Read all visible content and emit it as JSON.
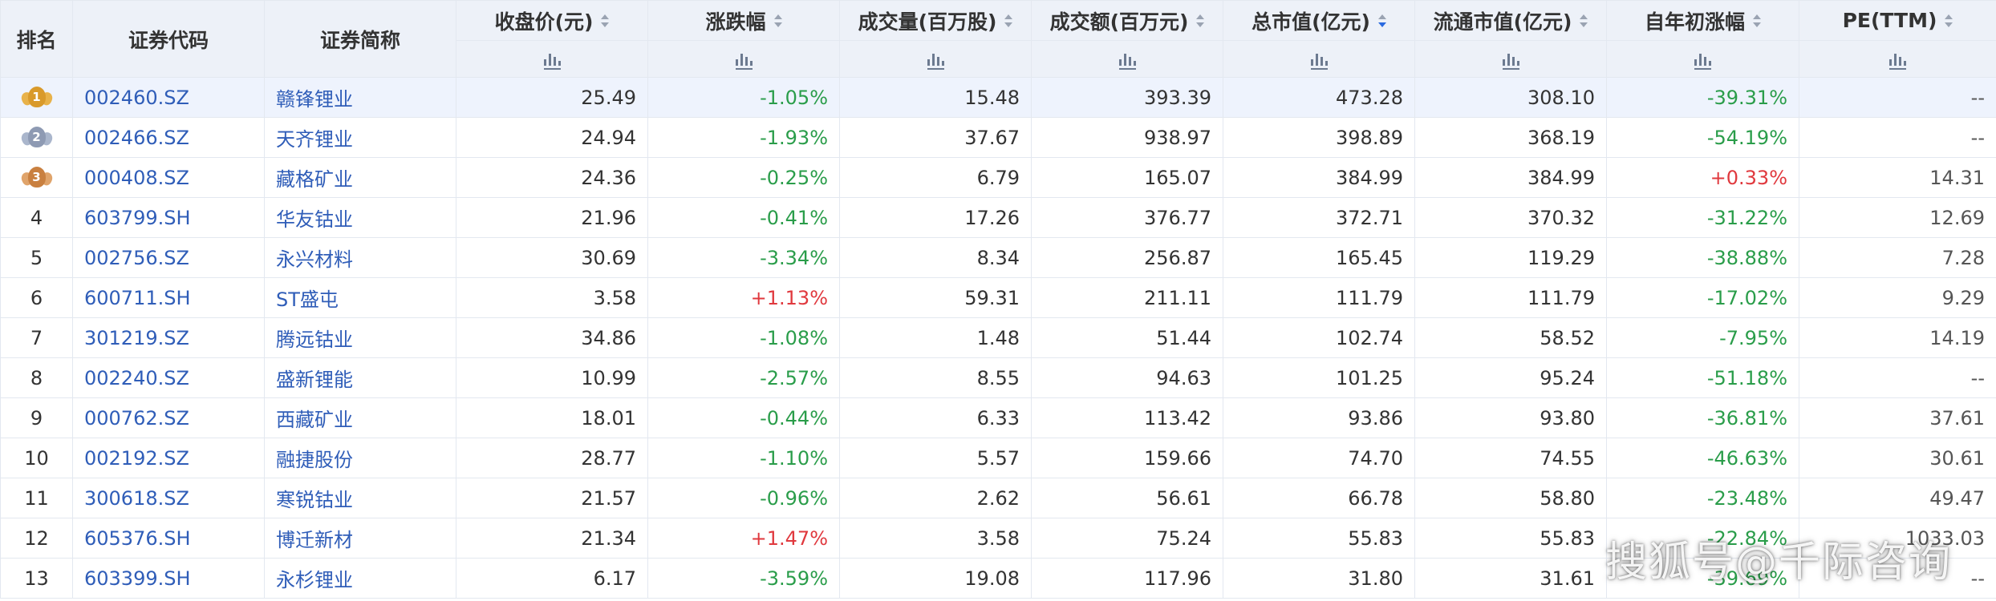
{
  "table": {
    "columns": [
      {
        "label": "排名",
        "sortable": false
      },
      {
        "label": "证券代码",
        "sortable": false
      },
      {
        "label": "证券简称",
        "sortable": false
      },
      {
        "label": "收盘价(元)",
        "sortable": true
      },
      {
        "label": "涨跌幅",
        "sortable": true
      },
      {
        "label": "成交量(百万股)",
        "sortable": true
      },
      {
        "label": "成交额(百万元)",
        "sortable": true
      },
      {
        "label": "总市值(亿元)",
        "sortable": true,
        "active_sort": "desc"
      },
      {
        "label": "流通市值(亿元)",
        "sortable": true
      },
      {
        "label": "自年初涨幅",
        "sortable": true
      },
      {
        "label": "PE(TTM)",
        "sortable": true
      }
    ],
    "rows": [
      {
        "rank": "1",
        "medal": "gold",
        "code": "002460.SZ",
        "name": "赣锋锂业",
        "close": "25.49",
        "change": "-1.05%",
        "change_dir": "neg",
        "volume": "15.48",
        "amount": "393.39",
        "mktcap": "473.28",
        "float_cap": "308.10",
        "ytd": "-39.31%",
        "ytd_dir": "neg",
        "pe": "--"
      },
      {
        "rank": "2",
        "medal": "silver",
        "code": "002466.SZ",
        "name": "天齐锂业",
        "close": "24.94",
        "change": "-1.93%",
        "change_dir": "neg",
        "volume": "37.67",
        "amount": "938.97",
        "mktcap": "398.89",
        "float_cap": "368.19",
        "ytd": "-54.19%",
        "ytd_dir": "neg",
        "pe": "--"
      },
      {
        "rank": "3",
        "medal": "bronze",
        "code": "000408.SZ",
        "name": "藏格矿业",
        "close": "24.36",
        "change": "-0.25%",
        "change_dir": "neg",
        "volume": "6.79",
        "amount": "165.07",
        "mktcap": "384.99",
        "float_cap": "384.99",
        "ytd": "+0.33%",
        "ytd_dir": "pos",
        "pe": "14.31"
      },
      {
        "rank": "4",
        "medal": "",
        "code": "603799.SH",
        "name": "华友钴业",
        "close": "21.96",
        "change": "-0.41%",
        "change_dir": "neg",
        "volume": "17.26",
        "amount": "376.77",
        "mktcap": "372.71",
        "float_cap": "370.32",
        "ytd": "-31.22%",
        "ytd_dir": "neg",
        "pe": "12.69"
      },
      {
        "rank": "5",
        "medal": "",
        "code": "002756.SZ",
        "name": "永兴材料",
        "close": "30.69",
        "change": "-3.34%",
        "change_dir": "neg",
        "volume": "8.34",
        "amount": "256.87",
        "mktcap": "165.45",
        "float_cap": "119.29",
        "ytd": "-38.88%",
        "ytd_dir": "neg",
        "pe": "7.28"
      },
      {
        "rank": "6",
        "medal": "",
        "code": "600711.SH",
        "name": "ST盛屯",
        "close": "3.58",
        "change": "+1.13%",
        "change_dir": "pos",
        "volume": "59.31",
        "amount": "211.11",
        "mktcap": "111.79",
        "float_cap": "111.79",
        "ytd": "-17.02%",
        "ytd_dir": "neg",
        "pe": "9.29"
      },
      {
        "rank": "7",
        "medal": "",
        "code": "301219.SZ",
        "name": "腾远钴业",
        "close": "34.86",
        "change": "-1.08%",
        "change_dir": "neg",
        "volume": "1.48",
        "amount": "51.44",
        "mktcap": "102.74",
        "float_cap": "58.52",
        "ytd": "-7.95%",
        "ytd_dir": "neg",
        "pe": "14.19"
      },
      {
        "rank": "8",
        "medal": "",
        "code": "002240.SZ",
        "name": "盛新锂能",
        "close": "10.99",
        "change": "-2.57%",
        "change_dir": "neg",
        "volume": "8.55",
        "amount": "94.63",
        "mktcap": "101.25",
        "float_cap": "95.24",
        "ytd": "-51.18%",
        "ytd_dir": "neg",
        "pe": "--"
      },
      {
        "rank": "9",
        "medal": "",
        "code": "000762.SZ",
        "name": "西藏矿业",
        "close": "18.01",
        "change": "-0.44%",
        "change_dir": "neg",
        "volume": "6.33",
        "amount": "113.42",
        "mktcap": "93.86",
        "float_cap": "93.80",
        "ytd": "-36.81%",
        "ytd_dir": "neg",
        "pe": "37.61"
      },
      {
        "rank": "10",
        "medal": "",
        "code": "002192.SZ",
        "name": "融捷股份",
        "close": "28.77",
        "change": "-1.10%",
        "change_dir": "neg",
        "volume": "5.57",
        "amount": "159.66",
        "mktcap": "74.70",
        "float_cap": "74.55",
        "ytd": "-46.63%",
        "ytd_dir": "neg",
        "pe": "30.61"
      },
      {
        "rank": "11",
        "medal": "",
        "code": "300618.SZ",
        "name": "寒锐钴业",
        "close": "21.57",
        "change": "-0.96%",
        "change_dir": "neg",
        "volume": "2.62",
        "amount": "56.61",
        "mktcap": "66.78",
        "float_cap": "58.80",
        "ytd": "-23.48%",
        "ytd_dir": "neg",
        "pe": "49.47"
      },
      {
        "rank": "12",
        "medal": "",
        "code": "605376.SH",
        "name": "博迁新材",
        "close": "21.34",
        "change": "+1.47%",
        "change_dir": "pos",
        "volume": "3.58",
        "amount": "75.24",
        "mktcap": "55.83",
        "float_cap": "55.83",
        "ytd": "-22.84%",
        "ytd_dir": "neg",
        "pe": "1033.03"
      },
      {
        "rank": "13",
        "medal": "",
        "code": "603399.SH",
        "name": "永杉锂业",
        "close": "6.17",
        "change": "-3.59%",
        "change_dir": "neg",
        "volume": "19.08",
        "amount": "117.96",
        "mktcap": "31.80",
        "float_cap": "31.61",
        "ytd": "-39.69%",
        "ytd_dir": "neg",
        "pe": "--"
      }
    ]
  },
  "colors": {
    "positive": "#e0393e",
    "negative": "#2a9d4a",
    "link": "#2f5db8",
    "header_bg": "#edf1f8"
  },
  "watermark": "搜狐号@千际咨询"
}
